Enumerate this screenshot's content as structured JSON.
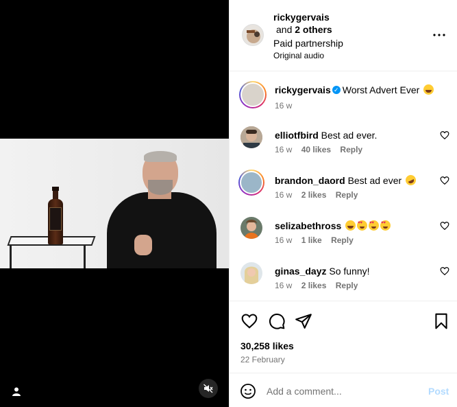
{
  "post": {
    "author": "rickygervais",
    "collaborators_prefix": "and",
    "collaborators_count": "2 others",
    "partnership": "Paid partnership",
    "audio": "Original audio"
  },
  "caption": {
    "username": "rickygervais",
    "text": "Worst Advert Ever",
    "emoji": "laughing-emoji",
    "time": "16 w"
  },
  "comments": [
    {
      "username": "elliotfbird",
      "text": "Best ad ever.",
      "time": "16 w",
      "likes": "40 likes",
      "reply": "Reply",
      "emojis": []
    },
    {
      "username": "brandon_daord",
      "text": "Best ad ever",
      "time": "16 w",
      "likes": "2 likes",
      "reply": "Reply",
      "emojis": [
        "rofl-emoji"
      ]
    },
    {
      "username": "selizabethross",
      "text": "",
      "time": "16 w",
      "likes": "1 like",
      "reply": "Reply",
      "emojis": [
        "laughing-emoji",
        "heart-eyes-emoji",
        "heart-eyes-emoji",
        "heart-eyes-emoji"
      ]
    },
    {
      "username": "ginas_dayz",
      "text": "So funny!",
      "time": "16 w",
      "likes": "2 likes",
      "reply": "Reply",
      "emojis": []
    }
  ],
  "stats": {
    "likes": "30,258 likes",
    "date": "22 February"
  },
  "composer": {
    "placeholder": "Add a comment...",
    "post_label": "Post"
  },
  "colors": {
    "accent": "#0095f6",
    "muted_text": "#737373",
    "post_disabled": "#b3dbff"
  }
}
